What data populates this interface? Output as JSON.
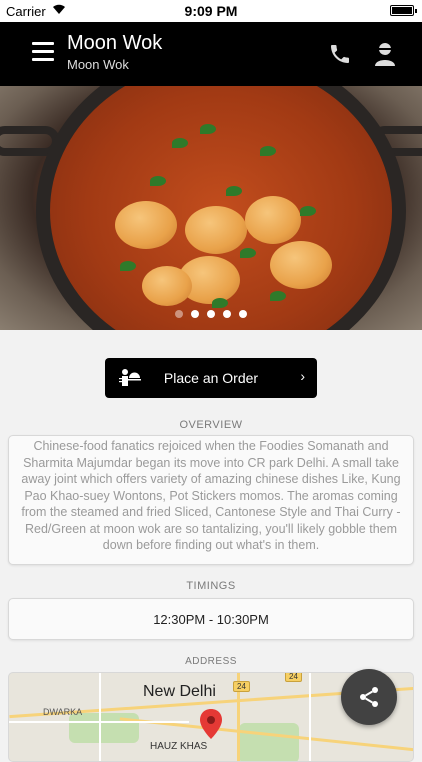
{
  "status_bar": {
    "carrier": "Carrier",
    "time": "9:09 PM"
  },
  "header": {
    "title": "Moon Wok",
    "subtitle": "Moon Wok",
    "icons": [
      "menu-icon",
      "phone-icon",
      "user-icon"
    ]
  },
  "hero": {
    "carousel": {
      "total": 5,
      "active_index": 0
    }
  },
  "order_button": {
    "label": "Place an Order",
    "chevron": "›",
    "icon": "waiter-icon"
  },
  "overview": {
    "label": "OVERVIEW",
    "text": "Chinese-food fanatics rejoiced when the Foodies Somanath and Sharmita Majumdar began its move into CR park Delhi. A small take away joint which offers variety of amazing chinese dishes Like, Kung Pao Khao-suey Wontons, Pot Stickers momos. The aromas coming from the steamed and fried Sliced, Cantonese Style and Thai Curry - Red/Green at moon wok are so tantalizing, you'll likely gobble them down before finding out what's in them."
  },
  "timings": {
    "label": "TIMINGS",
    "value": "12:30PM - 10:30PM"
  },
  "address": {
    "label": "ADDRESS",
    "map": {
      "city": "New Delhi",
      "area_left": "DWARKA",
      "area_bottom": "HAUZ KHAS",
      "highway_1": "24",
      "highway_2": "24"
    }
  },
  "colors": {
    "header_bg": "#000000",
    "button_bg": "#000000",
    "fab_bg": "#424242",
    "page_bg": "#f2f2f2"
  }
}
